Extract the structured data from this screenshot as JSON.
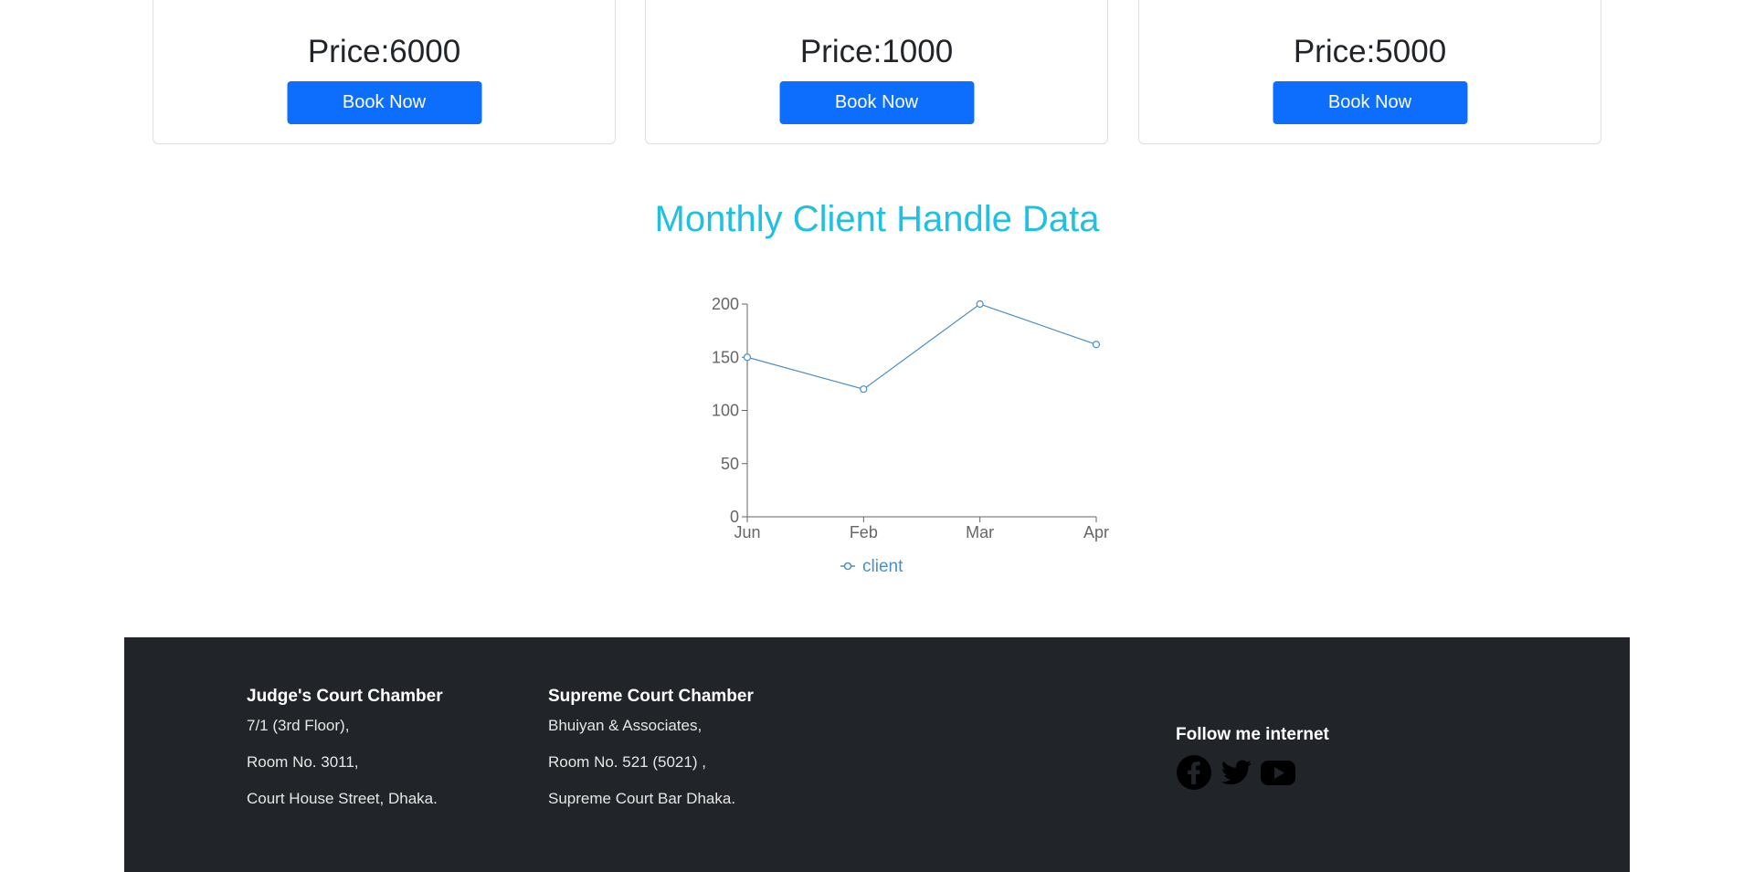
{
  "cards": [
    {
      "price": "Price:6000",
      "button": "Book Now"
    },
    {
      "price": "Price:1000",
      "button": "Book Now"
    },
    {
      "price": "Price:5000",
      "button": "Book Now"
    }
  ],
  "chart_title": "Monthly Client Handle Data",
  "chart_data": {
    "type": "line",
    "categories": [
      "Jun",
      "Feb",
      "Mar",
      "Apr"
    ],
    "series": [
      {
        "name": "client",
        "values": [
          150,
          120,
          200,
          162
        ]
      }
    ],
    "ylim": [
      0,
      200
    ],
    "yticks": [
      0,
      50,
      100,
      150,
      200
    ],
    "legend": "bottom",
    "color": "#4a90c6"
  },
  "footer": {
    "col1": {
      "title": "Judge's Court Chamber",
      "lines": [
        "7/1 (3rd Floor),",
        "Room No. 3011,",
        "Court House Street, Dhaka."
      ]
    },
    "col2": {
      "title": "Supreme Court Chamber",
      "lines": [
        "Bhuiyan & Associates,",
        "Room No. 521 (5021) ,",
        "Supreme Court Bar Dhaka."
      ]
    },
    "follow": {
      "title": "Follow me internet",
      "icons": [
        "facebook-icon",
        "twitter-icon",
        "youtube-icon"
      ]
    }
  }
}
